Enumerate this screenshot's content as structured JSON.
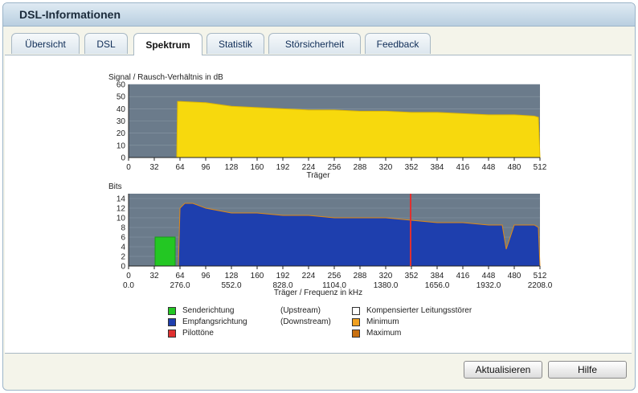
{
  "window": {
    "title": "DSL-Informationen"
  },
  "tabs": [
    {
      "label": "Übersicht"
    },
    {
      "label": "DSL"
    },
    {
      "label": "Spektrum"
    },
    {
      "label": "Statistik"
    },
    {
      "label": "Störsicherheit"
    },
    {
      "label": "Feedback"
    }
  ],
  "active_tab": "Spektrum",
  "colors": {
    "snr_fill": "#f7d90d",
    "snr_line": "#e0b800",
    "plot_bg": "#6b7b8b",
    "upstream": "#23c723",
    "downstream": "#1e3fae",
    "pilot": "#e03030",
    "minmax": "#e08a16"
  },
  "chart_data": [
    {
      "type": "area",
      "ylabel": "Signal / Rausch-Verhältnis in dB",
      "xlabel": "Träger",
      "xlim": [
        0,
        512
      ],
      "ylim": [
        0,
        60
      ],
      "yticks": [
        "0",
        "10",
        "20",
        "30",
        "40",
        "50",
        "60"
      ],
      "xticks": [
        "0",
        "32",
        "64",
        "96",
        "128",
        "160",
        "192",
        "224",
        "256",
        "288",
        "320",
        "352",
        "384",
        "416",
        "448",
        "480",
        "512"
      ],
      "series": [
        {
          "x": [
            0,
            60,
            61,
            64,
            96,
            128,
            160,
            192,
            224,
            256,
            288,
            320,
            352,
            384,
            416,
            448,
            480,
            505,
            510,
            512
          ],
          "y": [
            0,
            0,
            46,
            46,
            45,
            42,
            41,
            40,
            39,
            39,
            38,
            38,
            37,
            37,
            36,
            35,
            35,
            34,
            33,
            0
          ]
        }
      ]
    },
    {
      "type": "area",
      "ylabel": "Bits",
      "xlabel": "Träger / Frequenz in kHz",
      "xlim": [
        0,
        512
      ],
      "ylim": [
        0,
        15
      ],
      "yticks": [
        "0",
        "2",
        "4",
        "6",
        "8",
        "10",
        "12",
        "14"
      ],
      "xticks": [
        "0",
        "32",
        "64",
        "96",
        "128",
        "160",
        "192",
        "224",
        "256",
        "288",
        "320",
        "352",
        "384",
        "416",
        "448",
        "480",
        "512"
      ],
      "freq_ticks": [
        "0.0",
        "276.0",
        "552.0",
        "828.0",
        "1104.0",
        "1380.0",
        "1656.0",
        "1932.0",
        "2208.0"
      ],
      "series": [
        {
          "name": "Senderichtung (Upstream)",
          "x": [
            33,
            33,
            58,
            58
          ],
          "y": [
            0,
            6,
            6,
            0
          ]
        },
        {
          "name": "Empfangsrichtung (Downstream)",
          "x": [
            62,
            64,
            70,
            80,
            96,
            128,
            160,
            192,
            224,
            256,
            288,
            320,
            352,
            384,
            416,
            448,
            465,
            470,
            480,
            505,
            510,
            512
          ],
          "y": [
            0,
            12,
            13,
            13,
            12,
            11,
            11,
            10.5,
            10.5,
            10,
            10,
            10,
            9.5,
            9,
            9,
            8.5,
            8.5,
            3.5,
            8.5,
            8.5,
            8,
            0
          ]
        }
      ],
      "pilot_tone_x": 351
    }
  ],
  "legend": [
    {
      "label": "Senderichtung",
      "dir": "(Upstream)",
      "color": "#23c723"
    },
    {
      "label": "Empfangsrichtung",
      "dir": "(Downstream)",
      "color": "#1e3fae"
    },
    {
      "label": "Pilottöne",
      "dir": "",
      "color": "#e03030"
    },
    {
      "label": "Kompensierter Leitungsstörer",
      "dir": "",
      "color": "#ffffff"
    },
    {
      "label": "Minimum",
      "dir": "",
      "color": "#f0a020"
    },
    {
      "label": "Maximum",
      "dir": "",
      "color": "#c87010"
    }
  ],
  "buttons": {
    "refresh": "Aktualisieren",
    "help": "Hilfe"
  }
}
